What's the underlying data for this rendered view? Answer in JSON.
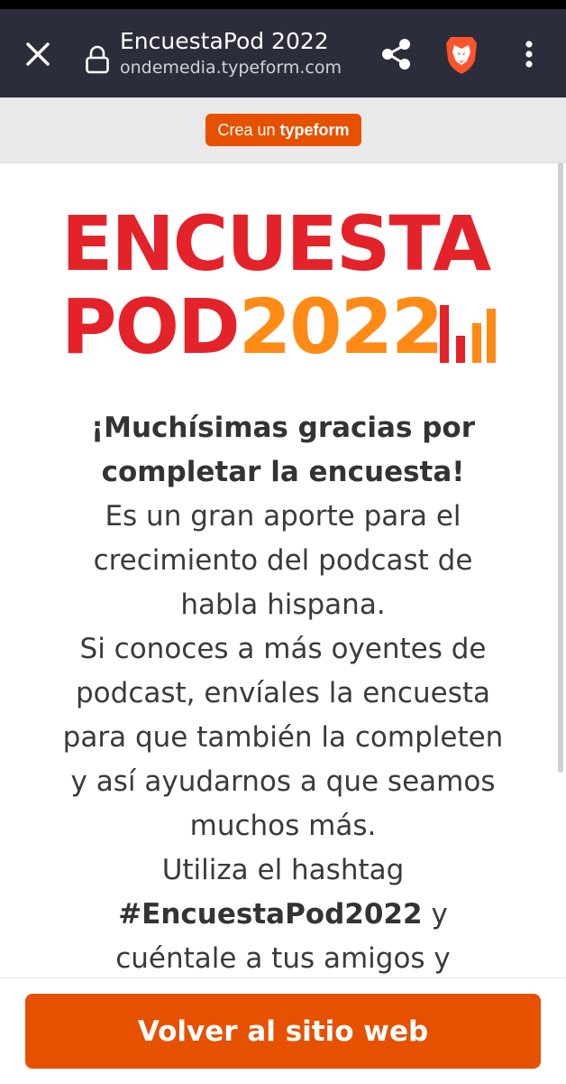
{
  "browser": {
    "title": "EncuestaPod 2022",
    "url": "ondemedia.typeform.com",
    "icons": {
      "close": "close-icon",
      "lock": "lock-icon",
      "share": "share-icon",
      "brave": "brave-lion-icon",
      "menu": "more-vert-icon"
    }
  },
  "banner": {
    "prefix": "Crea un",
    "brand": "typeform"
  },
  "logo": {
    "line1": "ENCUESTA",
    "line2_word": "POD",
    "line2_year": "2022",
    "colors": {
      "red": "#e4222a",
      "orange": "#ff8a16"
    }
  },
  "message": {
    "heading": "¡Muchísimas gracias por completar la encuesta!",
    "p1": "Es un gran aporte para el crecimiento del podcast de habla hispana.",
    "p2": "Si conoces a más oyentes de podcast, envíales la encuesta para que también la completen y así ayudarnos a que seamos muchos más.",
    "p3_before": "Utiliza el hashtag",
    "hashtag": "#EncuestaPod2022",
    "p3_after": "y cuéntale a tus amigos y"
  },
  "footer": {
    "button_label": "Volver al sitio web"
  },
  "colors": {
    "accent": "#e65100",
    "topbar": "#2b2d3a"
  }
}
